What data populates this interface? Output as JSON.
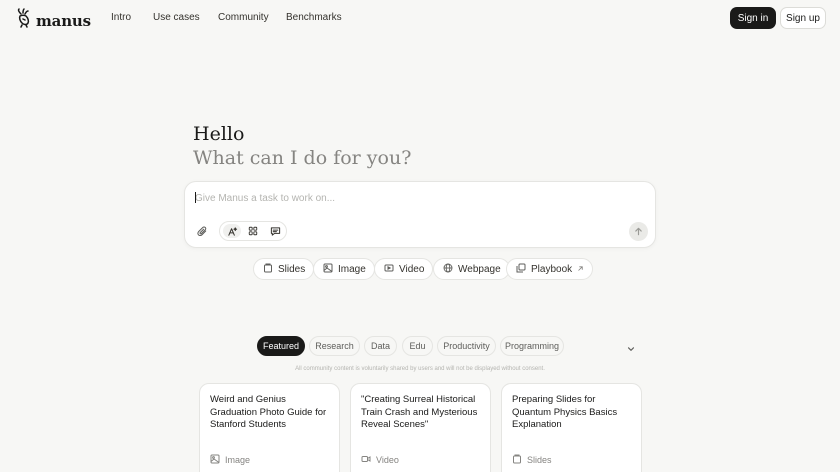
{
  "brand": {
    "name": "manus",
    "logo_icon": "manus-hand-icon"
  },
  "nav": {
    "links": [
      "Intro",
      "Use cases",
      "Community",
      "Benchmarks"
    ],
    "sign_in": "Sign in",
    "sign_up": "Sign up"
  },
  "hero": {
    "greeting": "Hello",
    "question": "What can I do for you?"
  },
  "composer": {
    "placeholder": "Give Manus a task to work on...",
    "value": "",
    "icons": {
      "attach": "paperclip-icon",
      "tools": [
        "agent-mode-icon",
        "apps-grid-icon",
        "chat-icon"
      ],
      "send": "arrow-up-icon"
    }
  },
  "quick_actions": [
    {
      "label": "Slides",
      "icon": "slides-icon"
    },
    {
      "label": "Image",
      "icon": "image-icon"
    },
    {
      "label": "Video",
      "icon": "video-icon"
    },
    {
      "label": "Webpage",
      "icon": "globe-icon"
    },
    {
      "label": "Playbook",
      "icon": "playbook-icon",
      "trailing_icon": "arrow-up-right-icon"
    }
  ],
  "gallery": {
    "tabs": [
      "Featured",
      "Research",
      "Data",
      "Edu",
      "Productivity",
      "Programming"
    ],
    "active_tab": "Featured",
    "disclaimer": "All community content is voluntarily shared by users and will not be displayed without consent.",
    "cards": [
      {
        "title": "Weird and Genius Graduation Photo Guide for Stanford Students",
        "tag": "Image",
        "icon": "image-icon"
      },
      {
        "title": "\"Creating Surreal Historical Train Crash and Mysterious Reveal Scenes\"",
        "tag": "Video",
        "icon": "video-icon"
      },
      {
        "title": "Preparing Slides for Quantum Physics Basics Explanation",
        "tag": "Slides",
        "icon": "slides-icon"
      }
    ]
  },
  "colors": {
    "background": "#f7f7f5",
    "primary_button": "#1a1a19",
    "muted_text": "#858481"
  }
}
